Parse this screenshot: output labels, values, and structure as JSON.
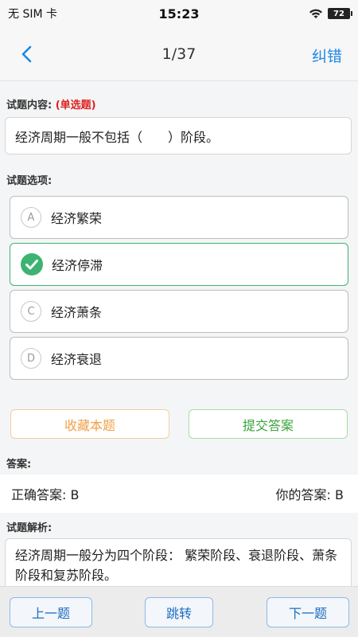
{
  "status_bar": {
    "carrier": "无 SIM 卡",
    "time": "15:23",
    "battery": "72"
  },
  "nav": {
    "progress": "1/37",
    "report_label": "纠错"
  },
  "question": {
    "label": "试题内容:",
    "type": "(单选题)",
    "text": "经济周期一般不包括（　　）阶段。"
  },
  "options_label": "试题选项:",
  "options": [
    {
      "letter": "A",
      "text": "经济繁荣",
      "selected": false
    },
    {
      "letter": "B",
      "text": "经济停滞",
      "selected": true
    },
    {
      "letter": "C",
      "text": "经济萧条",
      "selected": false
    },
    {
      "letter": "D",
      "text": "经济衰退",
      "selected": false
    }
  ],
  "actions": {
    "favorite_label": "收藏本题",
    "submit_label": "提交答案"
  },
  "answer": {
    "label": "答案:",
    "correct": "正确答案: B",
    "yours": "你的答案: B"
  },
  "analysis": {
    "label": "试题解析:",
    "text": "经济周期一般分为四个阶段： 繁荣阶段、衰退阶段、萧条阶段和复苏阶段。"
  },
  "bottom_nav": {
    "prev_label": "上一题",
    "jump_label": "跳转",
    "next_label": "下一题"
  },
  "colors": {
    "accent_blue": "#1e88e5",
    "selected_green": "#3cb371",
    "favorite_orange": "#f0a14a",
    "type_red": "#e02020"
  }
}
